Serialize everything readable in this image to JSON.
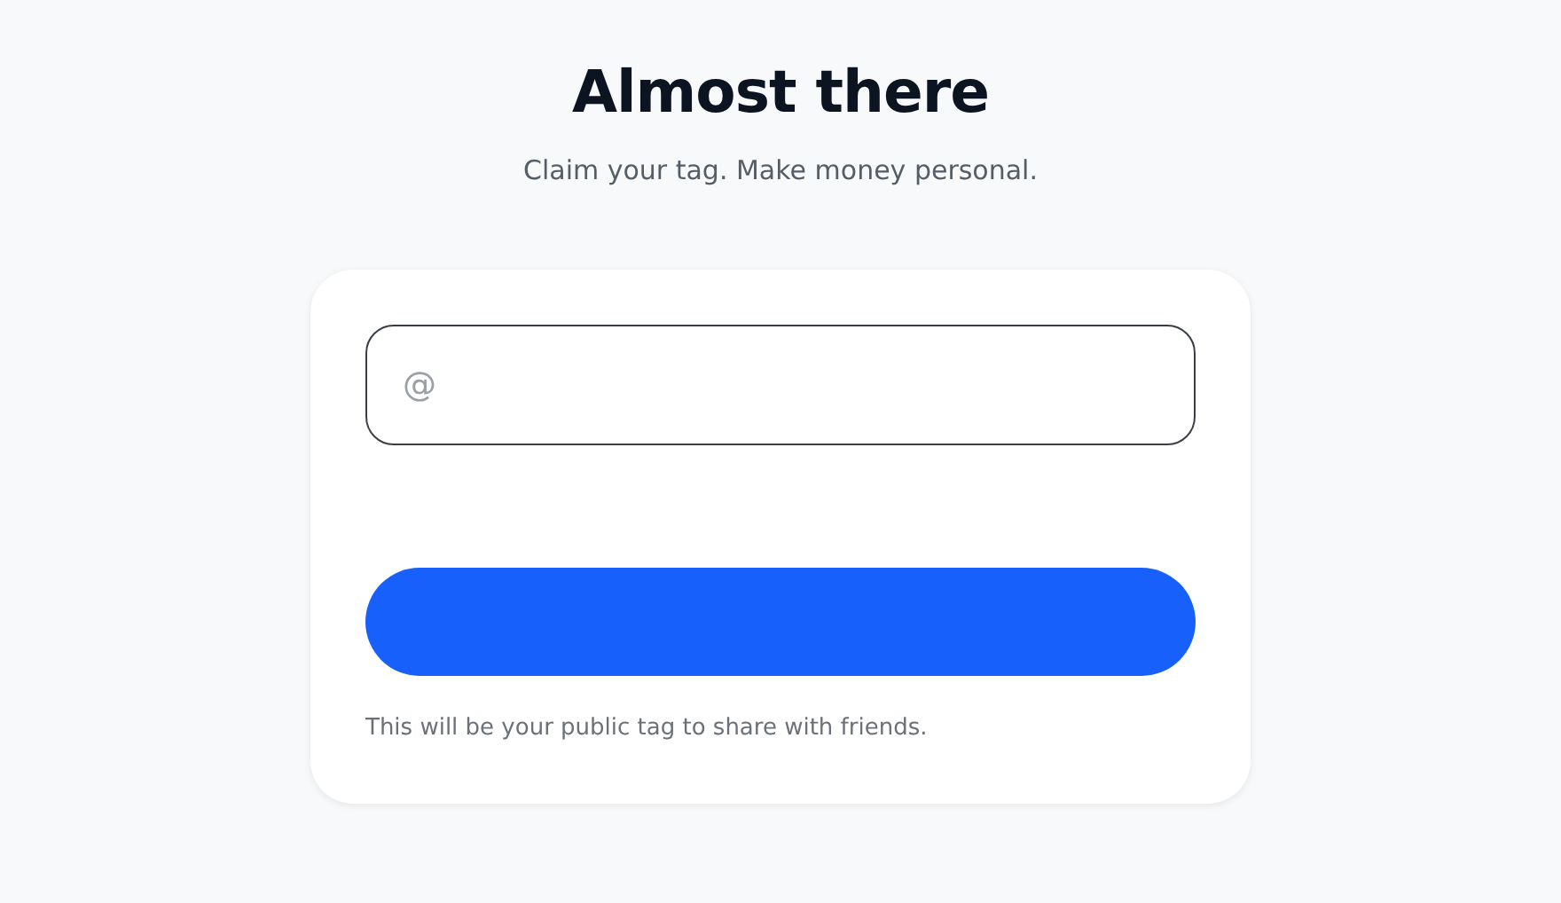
{
  "title": "Almost there",
  "subtitle": "Claim your tag. Make money personal.",
  "tag_field": {
    "prefix": "@"
  },
  "helper_text": "This will be your public tag to share with friends."
}
